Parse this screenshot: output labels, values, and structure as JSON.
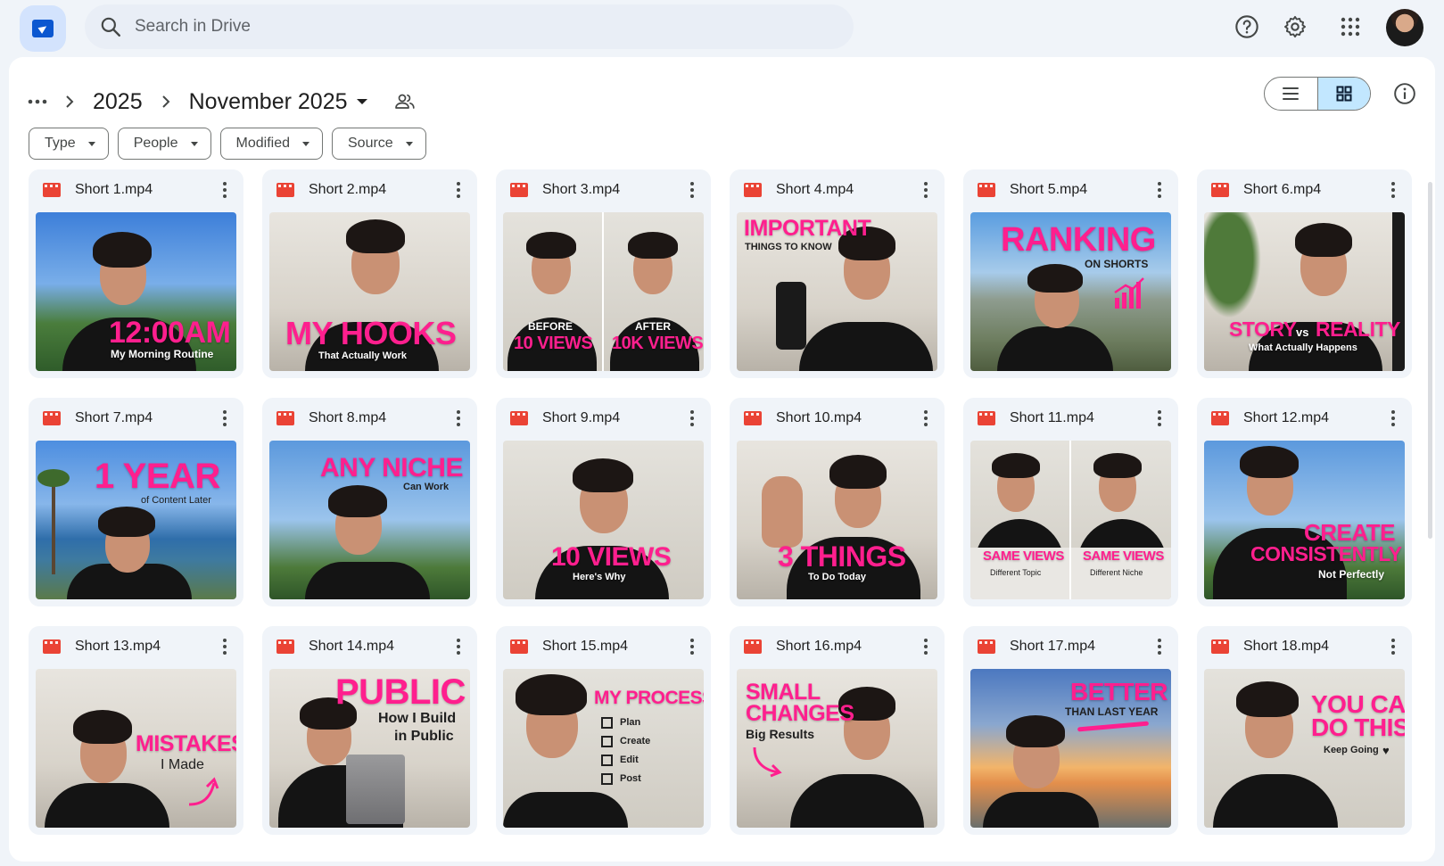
{
  "search": {
    "placeholder": "Search in Drive"
  },
  "breadcrumb": {
    "parent": "2025",
    "current": "November 2025"
  },
  "filters": [
    {
      "label": "Type"
    },
    {
      "label": "People"
    },
    {
      "label": "Modified"
    },
    {
      "label": "Source"
    }
  ],
  "colors": {
    "accent": "#ff1f8e",
    "video_icon": "#ea4335",
    "toggle_active": "#c2e7ff"
  },
  "files": [
    {
      "name": "Short 1.mp4",
      "title": "12:00AM",
      "subtitle": "My Morning Routine"
    },
    {
      "name": "Short 2.mp4",
      "title": "MY HOOKS",
      "subtitle": "That Actually Work"
    },
    {
      "name": "Short 3.mp4",
      "left_top": "BEFORE",
      "left_title": "10 VIEWS",
      "right_top": "AFTER",
      "right_title": "10K VIEWS"
    },
    {
      "name": "Short 4.mp4",
      "title": "IMPORTANT",
      "subtitle": "THINGS TO KNOW"
    },
    {
      "name": "Short 5.mp4",
      "title": "RANKING",
      "subtitle": "ON SHORTS"
    },
    {
      "name": "Short 6.mp4",
      "title_a": "STORY",
      "vs": "vs",
      "title_b": "REALITY",
      "subtitle": "What Actually Happens"
    },
    {
      "name": "Short 7.mp4",
      "title": "1 YEAR",
      "subtitle": "of Content Later"
    },
    {
      "name": "Short 8.mp4",
      "title": "ANY NICHE",
      "subtitle": "Can Work"
    },
    {
      "name": "Short 9.mp4",
      "title": "10 VIEWS",
      "subtitle": "Here's Why"
    },
    {
      "name": "Short 10.mp4",
      "title": "3 THINGS",
      "subtitle": "To Do Today"
    },
    {
      "name": "Short 11.mp4",
      "left_title": "SAME VIEWS",
      "left_sub": "Different Topic",
      "right_title": "SAME VIEWS",
      "right_sub": "Different Niche"
    },
    {
      "name": "Short 12.mp4",
      "title_a": "CREATE",
      "title_b": "CONSISTENTLY",
      "subtitle": "Not Perfectly"
    },
    {
      "name": "Short 13.mp4",
      "title": "MISTAKES",
      "subtitle": "I Made"
    },
    {
      "name": "Short 14.mp4",
      "title": "PUBLIC",
      "subtitle_a": "How I Build",
      "subtitle_b": "in Public"
    },
    {
      "name": "Short 15.mp4",
      "title": "MY PROCESS",
      "steps": [
        "Plan",
        "Create",
        "Edit",
        "Post"
      ]
    },
    {
      "name": "Short 16.mp4",
      "title_a": "SMALL",
      "title_b": "CHANGES",
      "subtitle": "Big Results"
    },
    {
      "name": "Short 17.mp4",
      "title": "BETTER",
      "subtitle": "THAN LAST YEAR"
    },
    {
      "name": "Short 18.mp4",
      "title_a": "YOU CAN",
      "title_b": "DO THIS",
      "subtitle": "Keep Going"
    }
  ]
}
